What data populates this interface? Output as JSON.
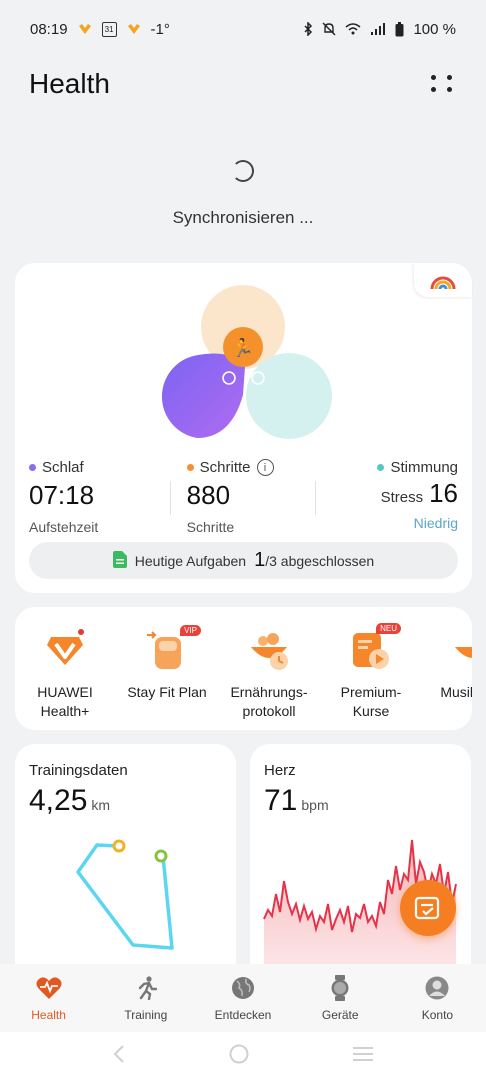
{
  "status_bar": {
    "time": "08:19",
    "calendar_day": "31",
    "temperature": "-1°",
    "battery": "100 %"
  },
  "app_bar": {
    "title": "Health",
    "more_icon": "more-dots-icon"
  },
  "sync": {
    "text": "Synchronisieren ..."
  },
  "summary": {
    "sleep": {
      "label": "Schlaf",
      "value": "07:18",
      "sub": "Aufstehzeit",
      "color": "#8b6cf0"
    },
    "steps": {
      "label": "Schritte",
      "value": "880",
      "sub": "Schritte",
      "color": "#f5912b"
    },
    "mood": {
      "label": "Stimmung",
      "stress_label": "Stress",
      "stress_value": "16",
      "sub": "Niedrig",
      "color": "#56c6c2"
    },
    "tasks": {
      "prefix": "Heutige Aufgaben",
      "done": "1",
      "suffix": "/3 abgeschlossen"
    }
  },
  "shortcuts": [
    {
      "label": "HUAWEI Health+",
      "icon": "huawei-health-plus-icon"
    },
    {
      "label": "Stay Fit Plan",
      "icon": "stay-fit-plan-icon",
      "badge": "VIP"
    },
    {
      "label": "Ernährungs-protokoll",
      "icon": "nutrition-log-icon"
    },
    {
      "label": "Premium-Kurse",
      "icon": "premium-courses-icon",
      "badge": "NEU"
    },
    {
      "label": "Musik schl",
      "icon": "music-icon"
    }
  ],
  "training_tile": {
    "title": "Trainingsdaten",
    "value": "4,25",
    "unit": "km"
  },
  "heart_tile": {
    "title": "Herz",
    "value": "71",
    "unit": "bpm"
  },
  "bottom_nav": [
    {
      "label": "Health",
      "icon": "heart-pulse-icon",
      "active": true
    },
    {
      "label": "Training",
      "icon": "running-icon",
      "active": false
    },
    {
      "label": "Entdecken",
      "icon": "globe-icon",
      "active": false
    },
    {
      "label": "Geräte",
      "icon": "watch-icon",
      "active": false
    },
    {
      "label": "Konto",
      "icon": "account-icon",
      "active": false
    }
  ],
  "colors": {
    "accent": "#f57e22",
    "active_nav": "#e2591f",
    "sleep": "#8b6cf0",
    "steps": "#f5912b",
    "mood": "#56c6c2"
  }
}
